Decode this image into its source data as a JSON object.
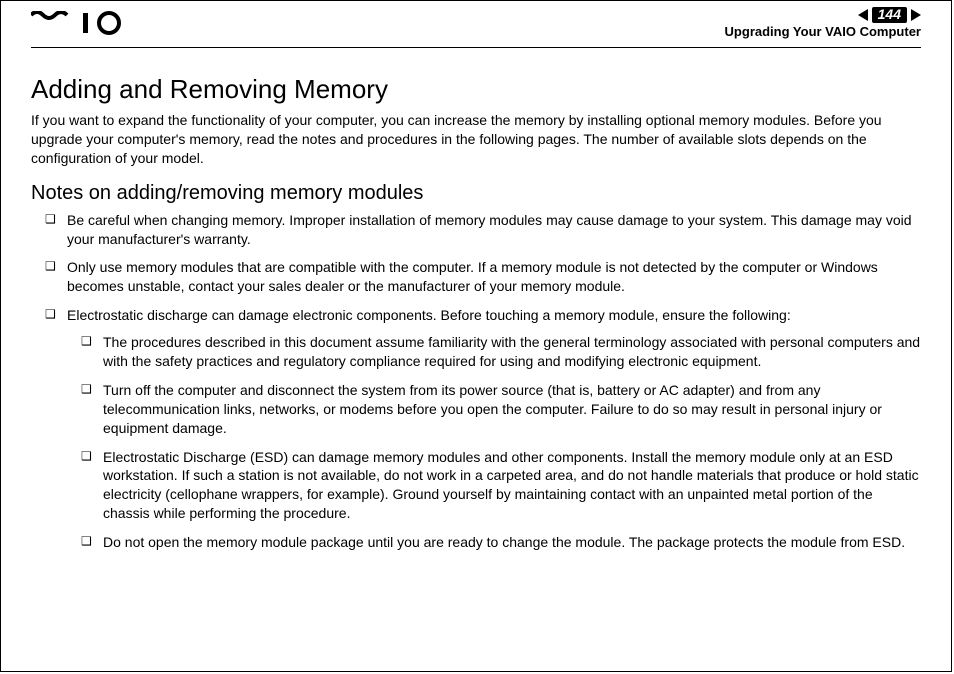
{
  "header": {
    "page_number": "144",
    "section_title": "Upgrading Your VAIO Computer"
  },
  "body": {
    "h1": "Adding and Removing Memory",
    "intro": "If you want to expand the functionality of your computer, you can increase the memory by installing optional memory modules. Before you upgrade your computer's memory, read the notes and procedures in the following pages. The number of available slots depends on the configuration of your model.",
    "h2": "Notes on adding/removing memory modules",
    "bullets": [
      "Be careful when changing memory. Improper installation of memory modules may cause damage to your system. This damage may void your manufacturer's warranty.",
      "Only use memory modules that are compatible with the computer. If a memory module is not detected by the computer or Windows becomes unstable, contact your sales dealer or the manufacturer of your memory module.",
      "Electrostatic discharge can damage electronic components. Before touching a memory module, ensure the following:"
    ],
    "sub_bullets": [
      "The procedures described in this document assume familiarity with the general terminology associated with personal computers and with the safety practices and regulatory compliance required for using and modifying electronic equipment.",
      "Turn off the computer and disconnect the system from its power source (that is, battery or AC adapter) and from any telecommunication links, networks, or modems before you open the computer. Failure to do so may result in personal injury or equipment damage.",
      "Electrostatic Discharge (ESD) can damage memory modules and other components. Install the memory module only at an ESD workstation. If such a station is not available, do not work in a carpeted area, and do not handle materials that produce or hold static electricity (cellophane wrappers, for example). Ground yourself by maintaining contact with an unpainted metal portion of the chassis while performing the procedure.",
      "Do not open the memory module package until you are ready to change the module. The package protects the module from ESD."
    ]
  }
}
